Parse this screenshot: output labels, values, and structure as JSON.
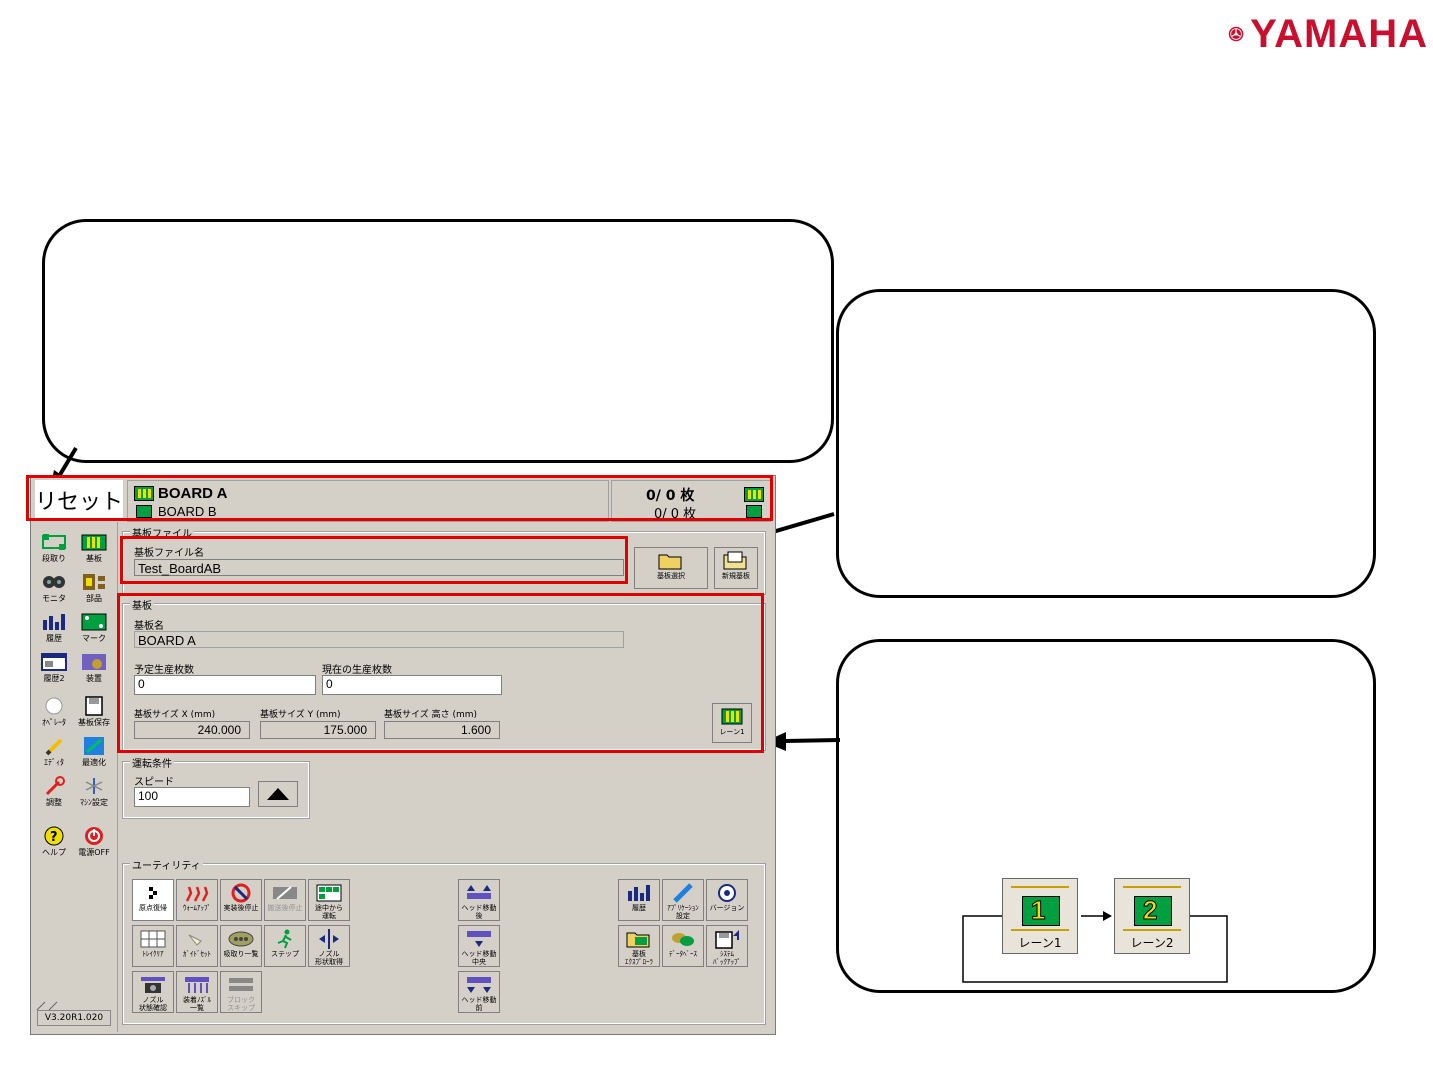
{
  "brand": {
    "name": "YAMAHA",
    "color": "#c8102e"
  },
  "status_bar": {
    "reset_label": "リセット",
    "board_primary": "BOARD A",
    "board_secondary": "BOARD B",
    "count_primary": "0/ 0 枚",
    "count_secondary": "0/ 0 枚"
  },
  "sidebar": {
    "items": [
      {
        "label": "段取り",
        "icon": "setup-icon"
      },
      {
        "label": "基板",
        "icon": "board-icon"
      },
      {
        "label": "モニタ",
        "icon": "monitor-icon"
      },
      {
        "label": "部品",
        "icon": "component-icon"
      },
      {
        "label": "履歴",
        "icon": "history-icon"
      },
      {
        "label": "マーク",
        "icon": "mark-icon"
      },
      {
        "label": "履歴2",
        "icon": "history2-icon"
      },
      {
        "label": "装置",
        "icon": "device-icon"
      },
      {
        "label": "ｵﾍﾟﾚｰﾀ",
        "icon": "operator-icon"
      },
      {
        "label": "基板保存",
        "icon": "save-icon"
      },
      {
        "label": "ｴﾃﾞｨﾀ",
        "icon": "editor-icon"
      },
      {
        "label": "最適化",
        "icon": "optimize-icon"
      },
      {
        "label": "調整",
        "icon": "adjust-icon"
      },
      {
        "label": "ﾏｼﾝ設定",
        "icon": "machine-settings-icon"
      },
      {
        "label": "ヘルプ",
        "icon": "help-icon"
      },
      {
        "label": "電源OFF",
        "icon": "power-icon"
      }
    ],
    "version": "V3.20R1.020"
  },
  "board_file": {
    "group_title": "基板ファイル",
    "name_label": "基板ファイル名",
    "name_value": "Test_BoardAB",
    "select_button": "基板選択",
    "new_button": "新規基板"
  },
  "board": {
    "group_title": "基板",
    "name_label": "基板名",
    "name_value": "BOARD A",
    "planned_label": "予定生産枚数",
    "planned_value": "0",
    "current_label": "現在の生産枚数",
    "current_value": "0",
    "size_x_label": "基板サイズ X (mm)",
    "size_x_value": "240.000",
    "size_y_label": "基板サイズ Y (mm)",
    "size_y_value": "175.000",
    "size_h_label": "基板サイズ 高さ (mm)",
    "size_h_value": "1.600",
    "lane_button": "レーン1"
  },
  "run_conditions": {
    "group_title": "運転条件",
    "speed_label": "スピード",
    "speed_value": "100"
  },
  "utility": {
    "group_title": "ユーティリティ",
    "tools": [
      {
        "label": "原点復帰",
        "icon": "origin-icon"
      },
      {
        "label": "ｳｫｰﾑｱｯﾌﾟ",
        "icon": "warmup-icon"
      },
      {
        "label": "実装後停止",
        "icon": "stop-after-mount-icon"
      },
      {
        "label": "搬送後停止",
        "icon": "stop-after-transfer-icon"
      },
      {
        "label": "途中から\n運転",
        "icon": "resume-icon"
      },
      {
        "label": "ﾄﾚｲｸﾘｱ",
        "icon": "tray-clear-icon"
      },
      {
        "label": "ｶﾞｲﾄﾞｾｯﾄ",
        "icon": "guide-set-icon"
      },
      {
        "label": "吸取り一覧",
        "icon": "pickup-list-icon"
      },
      {
        "label": "ステップ",
        "icon": "step-icon"
      },
      {
        "label": "ノズル\n形状取得",
        "icon": "nozzle-shape-icon"
      },
      {
        "label": "ノズル\n状態確認",
        "icon": "nozzle-status-icon"
      },
      {
        "label": "装着ﾉｽﾞﾙ\n一覧",
        "icon": "nozzle-list-icon"
      },
      {
        "label": "ブロック\nスキップ",
        "icon": "block-skip-icon"
      },
      {
        "label": "ヘッド移動\n後",
        "icon": "head-move-rear-icon"
      },
      {
        "label": "ヘッド移動\n中央",
        "icon": "head-move-center-icon"
      },
      {
        "label": "ヘッド移動\n前",
        "icon": "head-move-front-icon"
      },
      {
        "label": "履歴",
        "icon": "history-icon"
      },
      {
        "label": "ｱﾌﾟﾘｹｰｼｮﾝ\n設定",
        "icon": "app-settings-icon"
      },
      {
        "label": "バージョン",
        "icon": "version-icon"
      },
      {
        "label": "基板\nｴｸｽﾌﾟﾛｰﾗ",
        "icon": "board-explorer-icon"
      },
      {
        "label": "ﾃﾞｰﾀﾍﾞｰｽ",
        "icon": "database-icon"
      },
      {
        "label": "ｼｽﾃﾑ\nﾊﾞｯｸｱｯﾌﾟ",
        "icon": "system-backup-icon"
      }
    ]
  },
  "lane_diagram": {
    "lane1_label": "レーン1",
    "lane1_number": "1",
    "lane2_label": "レーン2",
    "lane2_number": "2"
  }
}
